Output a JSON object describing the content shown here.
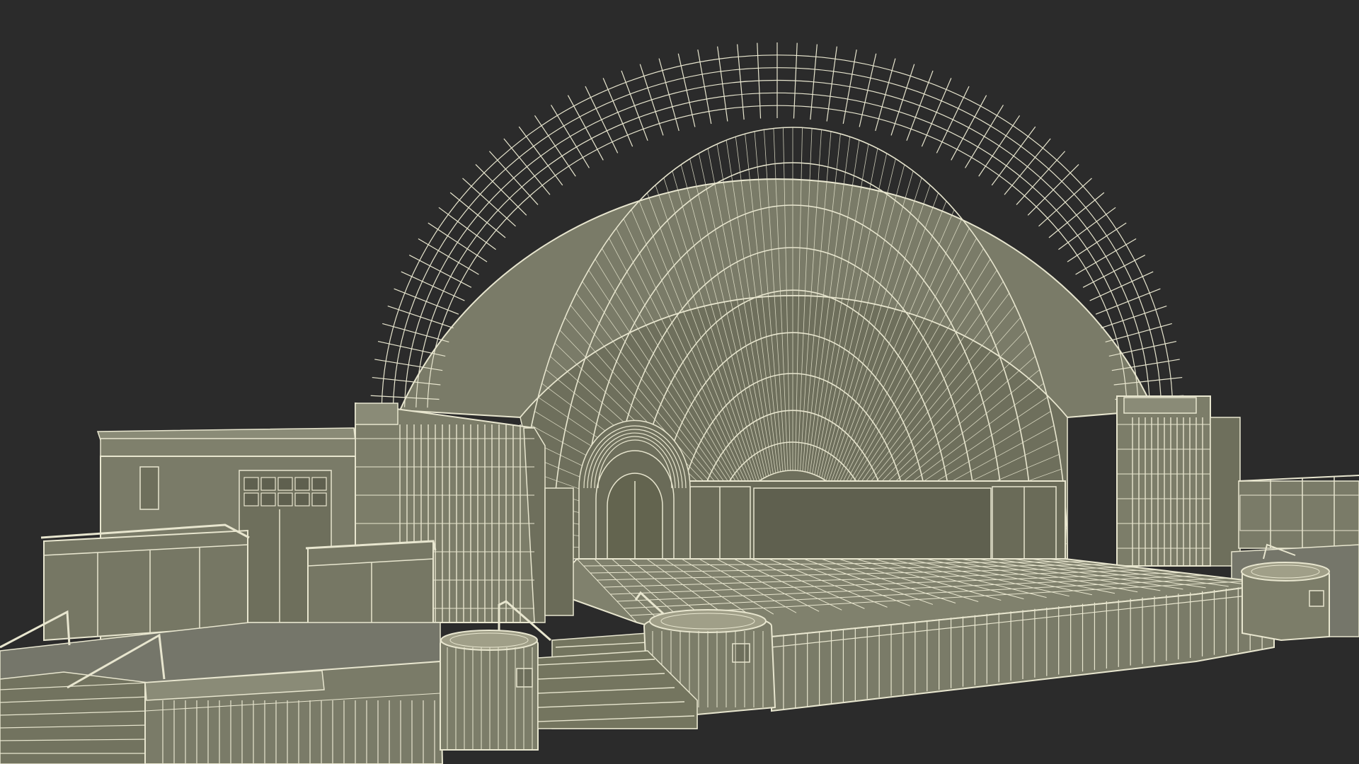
{
  "scene": {
    "subject": "bandshell-amphitheater-wireframe-model",
    "colors": {
      "background": "#2b2b2b",
      "surface": "#7a7b68",
      "surface_light": "#8a8b77",
      "surface_dark": "#5f604f",
      "inner_shell": "#6e6f5c",
      "wire": "#e8e6cf"
    }
  }
}
